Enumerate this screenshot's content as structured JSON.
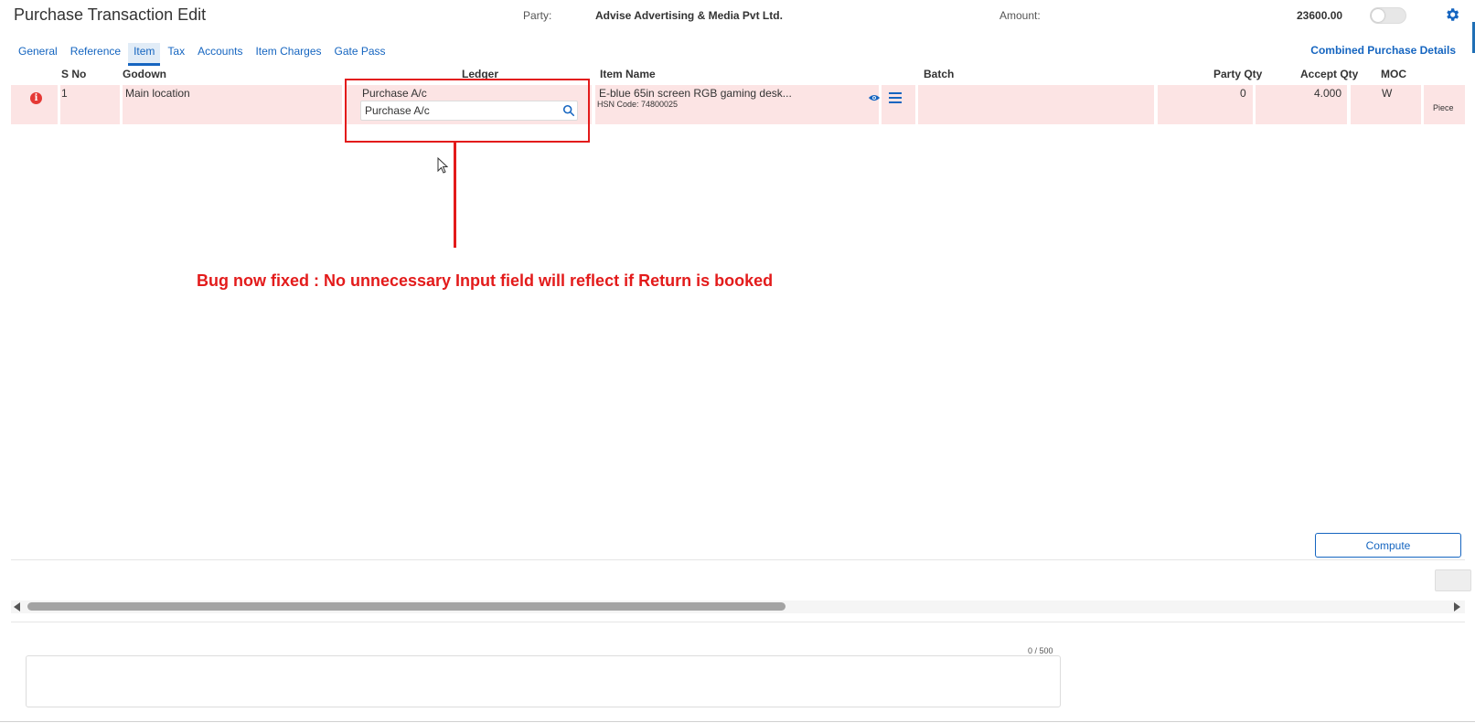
{
  "header": {
    "title": "Purchase Transaction Edit",
    "party_label": "Party:",
    "party_value": "Advise Advertising & Media Pvt Ltd.",
    "amount_label": "Amount:",
    "amount_value": "23600.00"
  },
  "tabs": [
    {
      "label": "General"
    },
    {
      "label": "Reference"
    },
    {
      "label": "Item",
      "active": true
    },
    {
      "label": "Tax"
    },
    {
      "label": "Accounts"
    },
    {
      "label": "Item Charges"
    },
    {
      "label": "Gate Pass"
    }
  ],
  "combined_link": "Combined Purchase Details",
  "columns": {
    "sno": "S No",
    "godown": "Godown",
    "ledger": "Ledger",
    "item_name": "Item Name",
    "batch": "Batch",
    "party_qty": "Party Qty",
    "accept_qty": "Accept Qty",
    "moc": "MOC"
  },
  "row": {
    "sno": "1",
    "godown": "Main location",
    "ledger": "Purchase A/c",
    "ledger_input": "Purchase A/c",
    "item_name": "E-blue 65in screen RGB gaming desk...",
    "hsn": "HSN Code: 74800025",
    "party_qty": "0",
    "accept_qty": "4.000",
    "moc": "W",
    "unit": "Piece"
  },
  "annotation": "Bug now fixed : No unnecessary Input field will reflect if Return is booked",
  "compute_label": "Compute",
  "char_count": "0 / 500",
  "colors": {
    "accent": "#1565c0",
    "error_row": "#fce4e4",
    "annotation_red": "#e31b1b"
  },
  "icons": [
    "gear-icon",
    "info-icon",
    "search-icon",
    "eye-icon",
    "menu-icon",
    "cursor-icon"
  ]
}
